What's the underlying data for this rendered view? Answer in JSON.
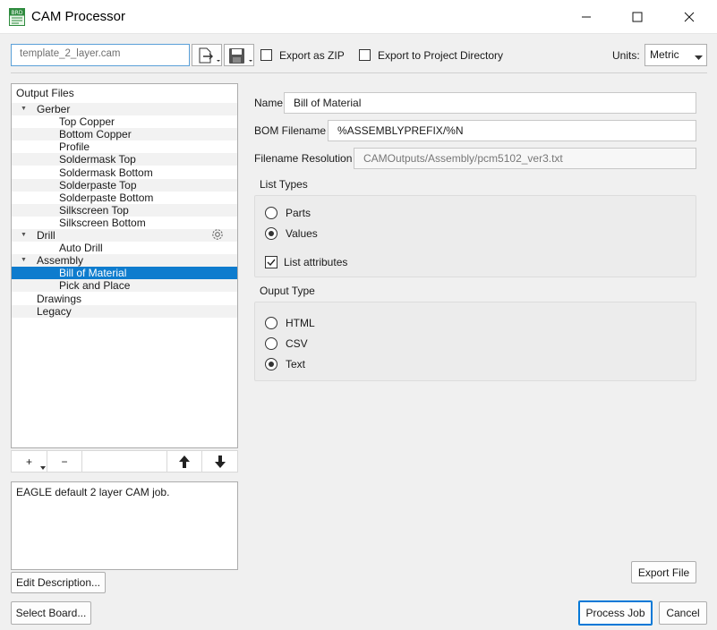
{
  "window": {
    "title": "CAM Processor",
    "icon_label": "BRD"
  },
  "toolbar": {
    "template_value": "template_2_layer.cam",
    "export_zip_label": "Export as ZIP",
    "export_project_label": "Export to Project Directory",
    "units_label": "Units:",
    "units_value": "Metric"
  },
  "tree": {
    "header": "Output Files",
    "items": [
      {
        "label": "Gerber",
        "level": 0
      },
      {
        "label": "Top Copper",
        "level": 1
      },
      {
        "label": "Bottom Copper",
        "level": 1
      },
      {
        "label": "Profile",
        "level": 1
      },
      {
        "label": "Soldermask Top",
        "level": 1
      },
      {
        "label": "Soldermask Bottom",
        "level": 1
      },
      {
        "label": "Solderpaste Top",
        "level": 1
      },
      {
        "label": "Solderpaste Bottom",
        "level": 1
      },
      {
        "label": "Silkscreen Top",
        "level": 1
      },
      {
        "label": "Silkscreen Bottom",
        "level": 1
      },
      {
        "label": "Drill",
        "level": 0
      },
      {
        "label": "Auto Drill",
        "level": 1
      },
      {
        "label": "Assembly",
        "level": 0
      },
      {
        "label": "Bill of Material",
        "level": 1
      },
      {
        "label": "Pick and Place",
        "level": 1
      },
      {
        "label": "Drawings",
        "level": 0
      },
      {
        "label": "Legacy",
        "level": 0
      }
    ],
    "add_label": "+",
    "remove_label": "−"
  },
  "description": "EAGLE default 2 layer CAM job.",
  "buttons": {
    "edit_description": "Edit Description...",
    "select_board": "Select Board...",
    "export_file": "Export File",
    "process_job": "Process Job",
    "cancel": "Cancel"
  },
  "form": {
    "name_label": "Name",
    "name_value": "Bill of Material",
    "bom_label": "BOM Filename",
    "bom_value": "%ASSEMBLYPREFIX/%N",
    "resolution_label": "Filename Resolution",
    "resolution_value": "CAMOutputs/Assembly/pcm5102_ver3.txt",
    "list_types_title": "List Types",
    "parts_label": "Parts",
    "values_label": "Values",
    "list_attributes_label": "List attributes",
    "output_type_title": "Ouput Type",
    "html_label": "HTML",
    "csv_label": "CSV",
    "text_label": "Text"
  },
  "colors": {
    "selection": "#0e7cce",
    "focus_border": "#5aa0d8",
    "default_button_border": "#0078d7"
  }
}
